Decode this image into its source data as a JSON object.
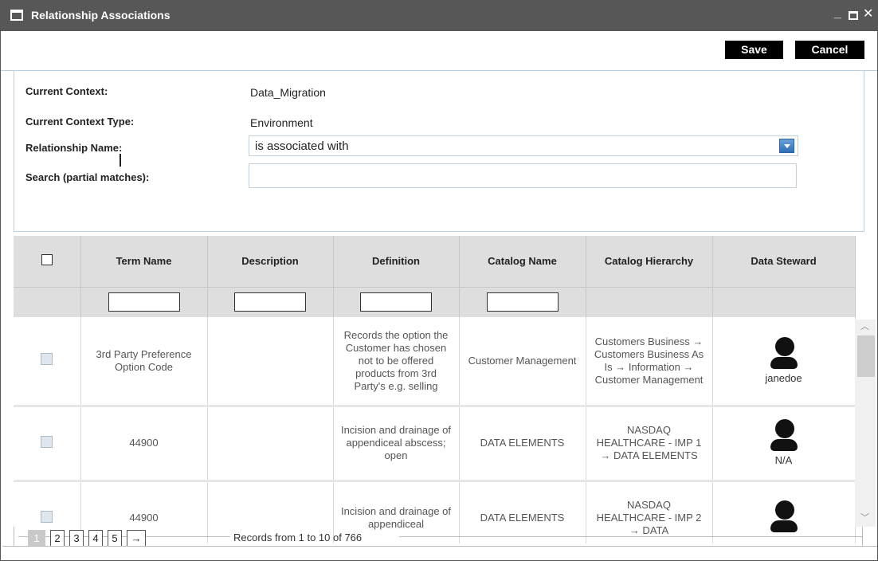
{
  "window": {
    "title": "Relationship Associations",
    "min_icon": "minimize-icon",
    "max_icon": "maximize-icon",
    "close_icon": "close-icon"
  },
  "toolbar": {
    "save_label": "Save",
    "cancel_label": "Cancel"
  },
  "form": {
    "context_label": "Current Context:",
    "context_value": "Data_Migration",
    "context_type_label": "Current Context Type:",
    "context_type_value": "Environment",
    "relationship_label": "Relationship Name:",
    "relationship_value": "is associated with",
    "search_label": "Search (partial matches):",
    "search_value": ""
  },
  "grid": {
    "columns": [
      "Term Name",
      "Description",
      "Definition",
      "Catalog Name",
      "Catalog Hierarchy",
      "Data Steward"
    ],
    "rows": [
      {
        "term": "3rd Party Preference Option Code",
        "description": "",
        "definition": "Records the option the Customer has chosen not to be offered products from 3rd Party's e.g. selling",
        "catalog": "Customer Management",
        "hierarchy": "Customers Business → Customers Business As Is → Information → Customer Management",
        "steward": "janedoe"
      },
      {
        "term": "44900",
        "description": "",
        "definition": "Incision and drainage of appendiceal abscess; open",
        "catalog": "DATA ELEMENTS",
        "hierarchy": "NASDAQ HEALTHCARE - IMP 1 → DATA ELEMENTS",
        "steward": "N/A"
      },
      {
        "term": "44900",
        "description": "",
        "definition": "Incision and drainage of appendiceal",
        "catalog": "DATA ELEMENTS",
        "hierarchy": "NASDAQ HEALTHCARE - IMP 2 → DATA",
        "steward": ""
      }
    ]
  },
  "pager": {
    "pages": [
      "1",
      "2",
      "3",
      "4",
      "5"
    ],
    "next": "→",
    "status": "Records from 1 to 10 of 766"
  },
  "colors": {
    "titlebar": "#575757",
    "button": "#000000",
    "header": "#dedede",
    "accent": "#2e6fb9"
  }
}
